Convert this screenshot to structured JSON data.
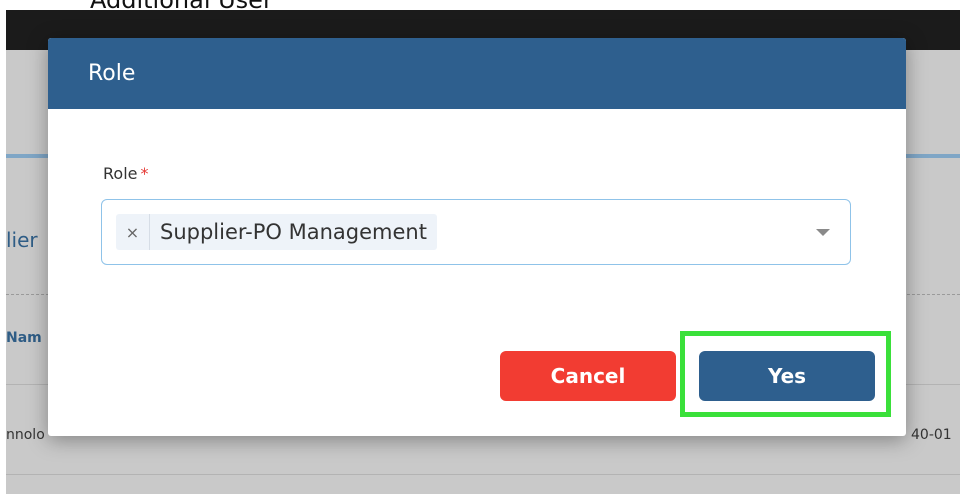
{
  "background": {
    "top_heading": "Additional User",
    "section_title": "lier",
    "column_header": "Nam",
    "row_left": "nnolo",
    "row_right": "40-01"
  },
  "modal": {
    "title": "Role",
    "field_label": "Role",
    "required_marker": "*",
    "selected_tag": "Supplier-PO Management",
    "tag_remove_glyph": "×",
    "cancel_label": "Cancel",
    "confirm_label": "Yes"
  },
  "colors": {
    "header_blue": "#2e5f8e",
    "cancel_red": "#f23c32",
    "highlight_green": "#3ae03a"
  }
}
